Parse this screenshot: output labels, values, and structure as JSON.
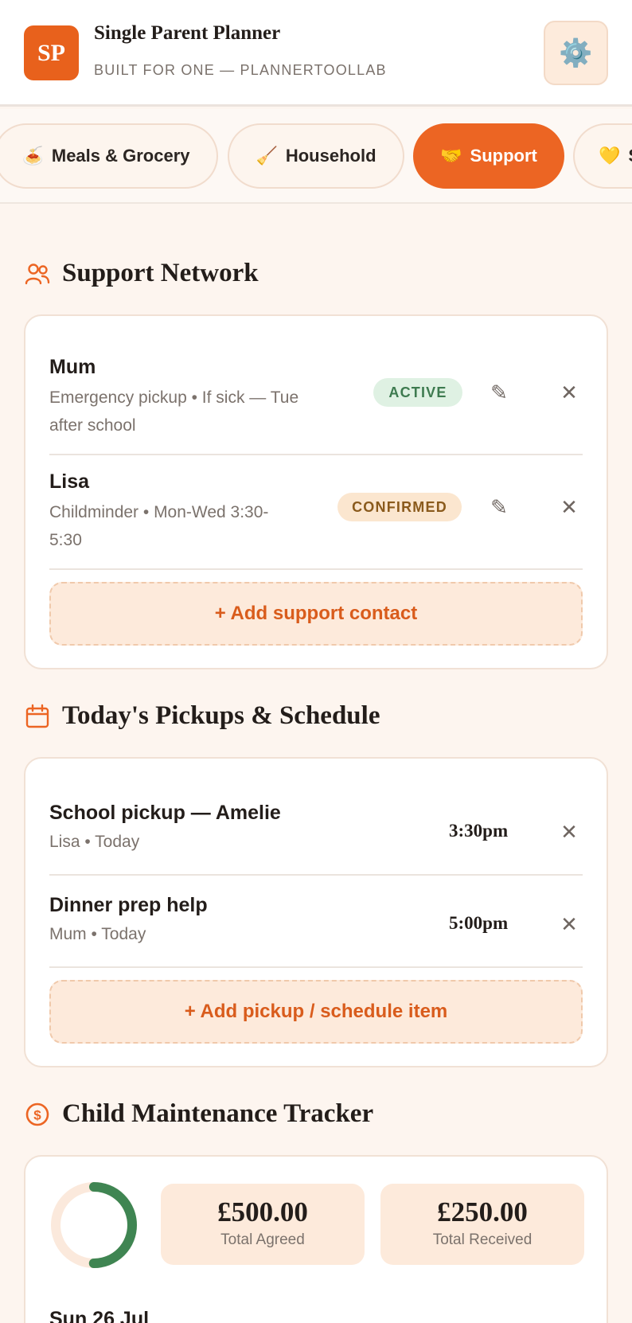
{
  "header": {
    "logo_text": "SP",
    "title": "Single Parent Planner",
    "subtitle": "BUILT FOR ONE — PLANNERTOOLLAB",
    "settings_icon": "⚙️"
  },
  "tabs": [
    {
      "icon": "🍝",
      "label": "Meals & Grocery"
    },
    {
      "icon": "🧹",
      "label": "Household"
    },
    {
      "icon": "🤝",
      "label": "Support",
      "active": true
    },
    {
      "icon": "💛",
      "label": "S"
    }
  ],
  "support_network": {
    "title": "Support Network",
    "contacts": [
      {
        "name": "Mum",
        "detail_line1": "Emergency pickup • If sick — Tue",
        "detail_line2": "after school",
        "status": "ACTIVE"
      },
      {
        "name": "Lisa",
        "detail_line1": "Childminder • Mon-Wed 3:30-",
        "detail_line2": "5:30",
        "status": "CONFIRMED"
      }
    ],
    "add_label": "+ Add support contact",
    "edit_icon": "✎",
    "remove_icon": "✕"
  },
  "schedule": {
    "title": "Today's Pickups & Schedule",
    "items": [
      {
        "title": "School pickup — Amelie",
        "detail": "Lisa • Today",
        "time": "3:30pm"
      },
      {
        "title": "Dinner prep help",
        "detail": "Mum • Today",
        "time": "5:00pm"
      }
    ],
    "add_label": "+ Add pickup / schedule item",
    "remove_icon": "✕"
  },
  "maintenance": {
    "title": "Child Maintenance Tracker",
    "progress_fraction": 0.5,
    "total_agreed_value": "£500.00",
    "total_agreed_label": "Total Agreed",
    "total_received_value": "£250.00",
    "total_received_label": "Total Received",
    "entries": [
      {
        "date": "Sun 26 Jul"
      }
    ]
  },
  "colors": {
    "accent": "#ec6523",
    "progress": "#3f8552",
    "progress_track": "#fbe9dc"
  }
}
